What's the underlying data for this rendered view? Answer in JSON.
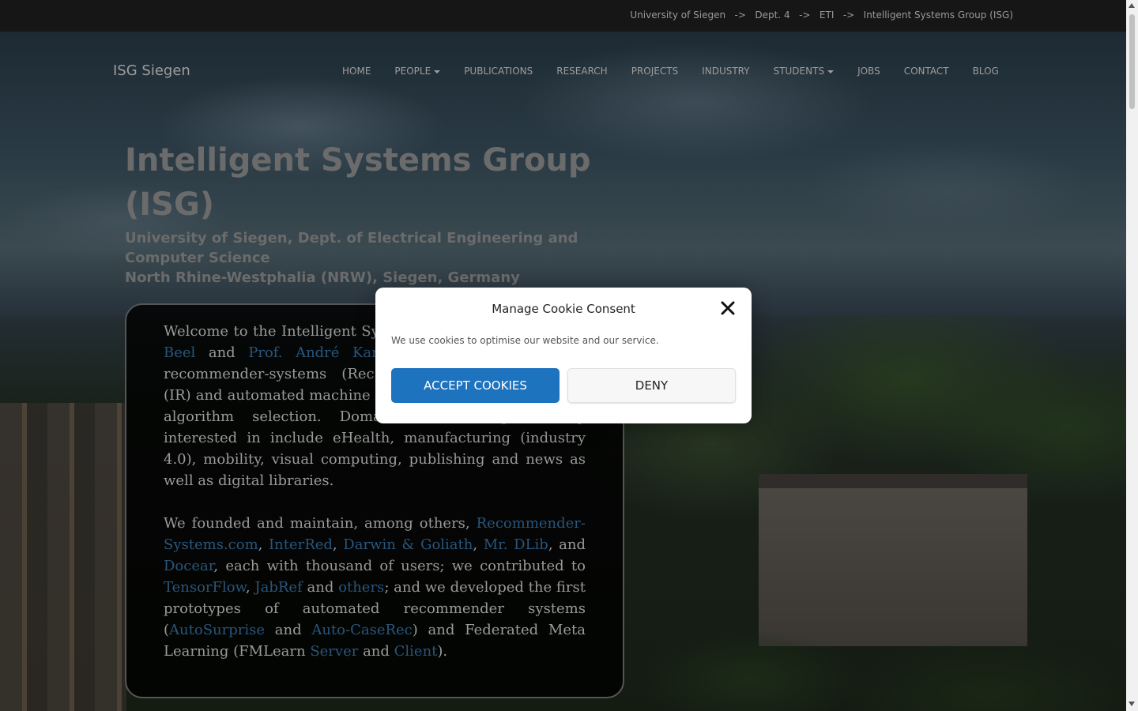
{
  "breadcrumb": [
    "University of Siegen",
    "->",
    "Dept. 4",
    "->",
    "ETI",
    "->",
    "Intelligent Systems Group (ISG)"
  ],
  "brand": "ISG Siegen",
  "nav": [
    {
      "label": "HOME",
      "dropdown": false
    },
    {
      "label": "PEOPLE",
      "dropdown": true
    },
    {
      "label": "PUBLICATIONS",
      "dropdown": false
    },
    {
      "label": "RESEARCH",
      "dropdown": false
    },
    {
      "label": "PROJECTS",
      "dropdown": false
    },
    {
      "label": "INDUSTRY",
      "dropdown": false
    },
    {
      "label": "STUDENTS",
      "dropdown": true
    },
    {
      "label": "JOBS",
      "dropdown": false
    },
    {
      "label": "CONTACT",
      "dropdown": false
    },
    {
      "label": "BLOG",
      "dropdown": false
    }
  ],
  "hero": {
    "title": "Intelligent Systems Group (ISG)",
    "subtitle_line1": "University of Siegen, Dept. of Electrical Engineering and Computer Science",
    "subtitle_line2": "North Rhine-Westphalia (NRW), Siegen, Germany"
  },
  "intro": {
    "p1": {
      "t1": "Welcome to the Intelligent Systems Group (ISG) of ",
      "link1": "Joeran Beel",
      "t2": " and ",
      "link2": "Prof. André Karge",
      "t3": ". We are interested in recommender-systems (RecSys), information retrieval (IR) and automated machine learning (AutoML), including algorithm selection. Domains we are particularly interested in include eHealth, manufacturing (industry 4.0), mobility, visual computing, publishing and news as well as digital libraries."
    },
    "p2": {
      "t1": "We founded and maintain, among others, ",
      "link_recsys": "Recommender-Systems.com",
      "sep1": ", ",
      "link_interred": "InterRed",
      "sep2": ", ",
      "link_darwin": "Darwin & Goliath",
      "sep3": ", ",
      "link_mrdlib": "Mr. DLib",
      "t2": ", and ",
      "link_docear": "Docear",
      "t3": ", each with thousand of users; we contributed to ",
      "link_tensorflow": "TensorFlow",
      "sep4": ", ",
      "link_jabref": "JabRef",
      "t4": " and ",
      "link_others": "others",
      "t5": "; and we developed the first prototypes of automated recommender systems (",
      "link_autosurprise": "AutoSurprise",
      "t6": " and ",
      "link_autocaserec": "Auto-CaseRec",
      "t7": ") and Federated Meta Learning (FMLearn ",
      "link_server": "Server",
      "t8": " and ",
      "link_client": "Client",
      "t9": ")."
    }
  },
  "cookie": {
    "title": "Manage Cookie Consent",
    "message": "We use cookies to optimise our website and our service.",
    "accept_label": "ACCEPT COOKIES",
    "deny_label": "DENY",
    "close_icon": "close-icon"
  },
  "colors": {
    "accept_bg": "#1e73be",
    "link": "#28567d",
    "topbar_bg": "#161616"
  }
}
